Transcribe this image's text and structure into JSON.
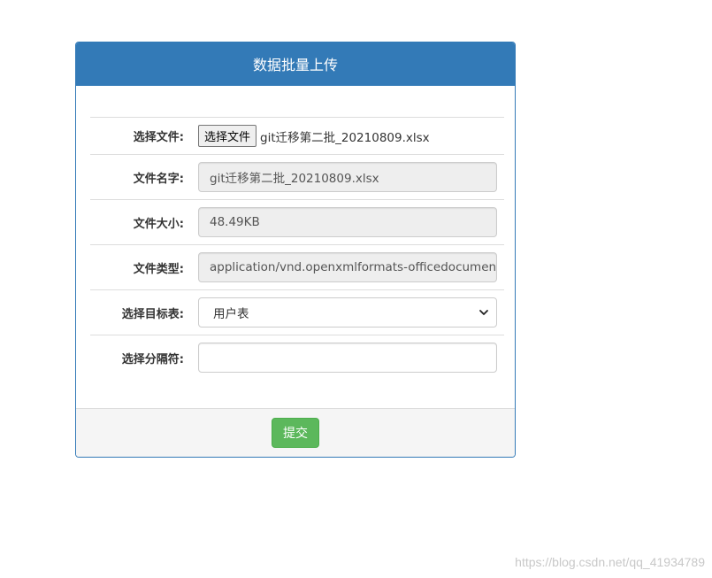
{
  "panel": {
    "title": "数据批量上传"
  },
  "form": {
    "file": {
      "label": "选择文件:",
      "button_label": "选择文件",
      "chosen_file": "git迁移第二批_20210809.xlsx"
    },
    "file_name": {
      "label": "文件名字:",
      "value": "git迁移第二批_20210809.xlsx"
    },
    "file_size": {
      "label": "文件大小:",
      "value": "48.49KB"
    },
    "file_type": {
      "label": "文件类型:",
      "value": "application/vnd.openxmlformats-officedocument.spreadsheetml.sheet"
    },
    "target_table": {
      "label": "选择目标表:",
      "selected": "用户表"
    },
    "separator": {
      "label": "选择分隔符:",
      "value": ""
    }
  },
  "footer": {
    "submit_label": "提交"
  },
  "watermark": {
    "url": "https://blog.csdn.net/qq_41934789"
  },
  "colors": {
    "panel_primary": "#337ab7",
    "submit_green": "#5cb85c",
    "readonly_bg": "#eeeeee",
    "footer_bg": "#f5f5f5"
  },
  "icons": {
    "select_arrow": "chevron-down-icon"
  }
}
